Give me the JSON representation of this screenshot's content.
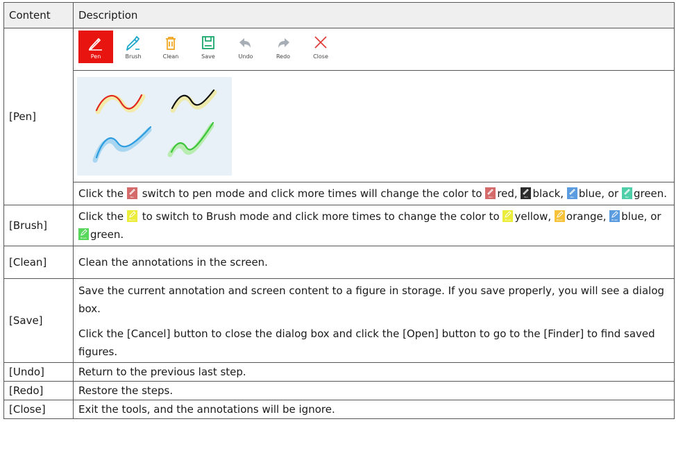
{
  "header": {
    "col1": "Content",
    "col2": "Description"
  },
  "toolbar": {
    "items": [
      {
        "label": "Pen",
        "icon": "pen-icon",
        "color": "#ffffff"
      },
      {
        "label": "Brush",
        "icon": "brush-icon",
        "color": "#1aa6c9"
      },
      {
        "label": "Clean",
        "icon": "trash-icon",
        "color": "#f0a21a"
      },
      {
        "label": "Save",
        "icon": "save-icon",
        "color": "#17a86a"
      },
      {
        "label": "Undo",
        "icon": "undo-icon",
        "color": "#a8aeb6"
      },
      {
        "label": "Redo",
        "icon": "redo-icon",
        "color": "#a8aeb6"
      },
      {
        "label": "Close",
        "icon": "close-icon",
        "color": "#e03a3a"
      }
    ],
    "active_color": "#e8140f"
  },
  "rows": {
    "pen": {
      "name": "[Pen]",
      "t1": "Click the",
      "t2": "switch to pen mode and click more times will change the color to",
      "t3": "red,",
      "t4": "black,",
      "t5": "blue,",
      "t6": "or",
      "t7": "green.",
      "mini_label": "Pen",
      "colors": {
        "red": "#d46a6a",
        "black": "#2b2b2b",
        "blue": "#5b9be0",
        "green": "#4fcfa8"
      }
    },
    "brush": {
      "name": "[Brush]",
      "t1": "Click the",
      "t2": "to switch to Brush mode and click more times to change the color to",
      "t3": "yellow,",
      "t4": "orange,",
      "t5": "blue, or",
      "t6": "green.",
      "mini_label": "Brush",
      "colors": {
        "yellow": "#ecec3a",
        "orange": "#f5c23a",
        "blue": "#5b9be0",
        "green": "#58d85a"
      }
    },
    "clean": {
      "name": "[Clean]",
      "desc": "Clean the annotations in the screen."
    },
    "save": {
      "name": "[Save]",
      "p1": "Save the current annotation and screen content to a figure in storage. If you save properly, you will see a dialog box.",
      "p2": "Click the [Cancel] button to close the dialog box and click the [Open] button to go to the [Finder] to find saved figures."
    },
    "undo": {
      "name": "[Undo]",
      "desc": "Return to the previous last step."
    },
    "redo": {
      "name": "[Redo]",
      "desc": "Restore the steps."
    },
    "close": {
      "name": "[Close]",
      "desc": "Exit the tools, and the annotations will be ignore."
    }
  }
}
